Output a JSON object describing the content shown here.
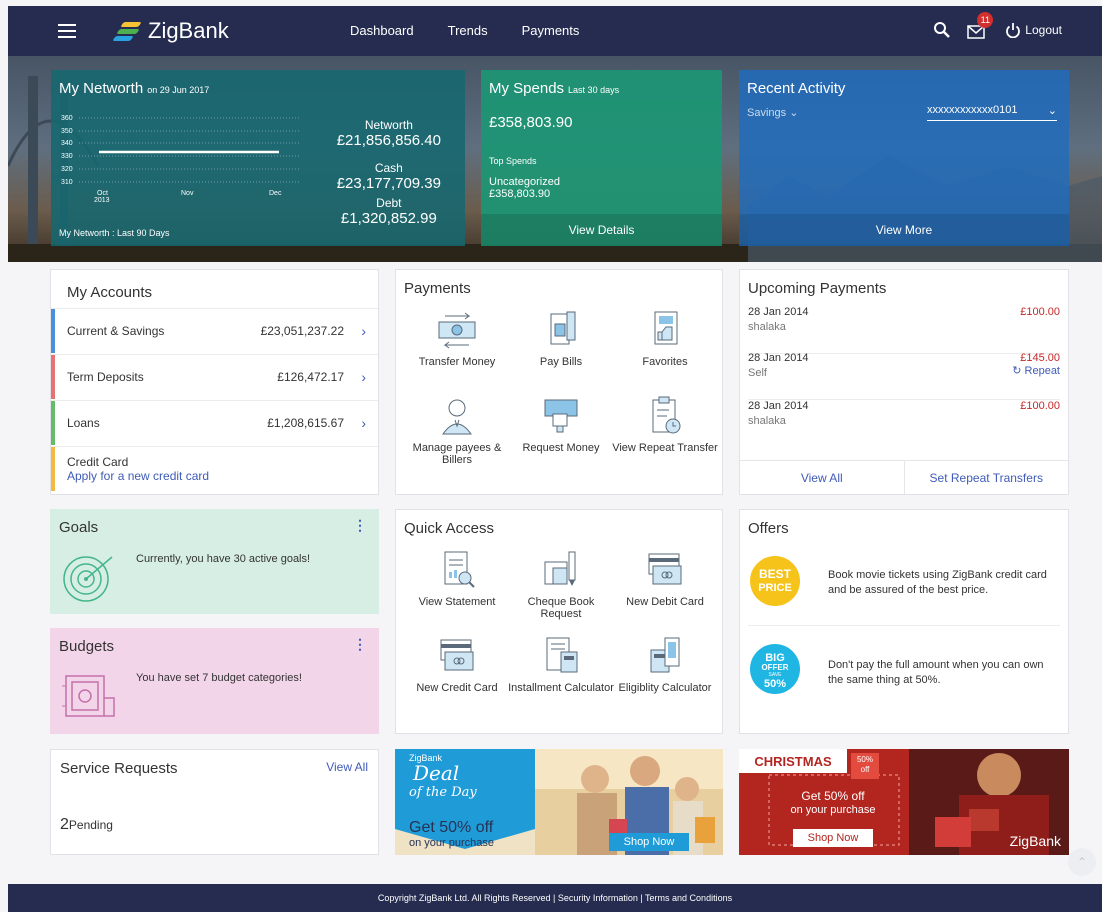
{
  "header": {
    "brand": "ZigBank",
    "nav": [
      "Dashboard",
      "Trends",
      "Payments"
    ],
    "mail_count": "11",
    "logout": "Logout"
  },
  "networth": {
    "title": "My Networth",
    "date": "on 29 Jun 2017",
    "y_ticks": [
      "360",
      "350",
      "340",
      "330",
      "320",
      "310"
    ],
    "x_ticks": [
      "Oct\n2013",
      "Nov",
      "Dec"
    ],
    "networth_label": "Networth",
    "networth_value": "£21,856,856.40",
    "cash_label": "Cash",
    "cash_value": "£23,177,709.39",
    "debt_label": "Debt",
    "debt_value": "£1,320,852.99",
    "footer": "My Networth : Last 90 Days"
  },
  "spends": {
    "title": "My Spends",
    "period": "Last 30 days",
    "amount": "£358,803.90",
    "top_label": "Top Spends",
    "category": "Uncategorized",
    "category_amount": "£358,803.90",
    "action": "View Details"
  },
  "activity": {
    "title": "Recent Activity",
    "filter": "Savings",
    "account": "xxxxxxxxxxxx0101",
    "action": "View More"
  },
  "accounts": {
    "title": "My Accounts",
    "rows": [
      {
        "name": "Current & Savings",
        "amount": "£23,051,237.22",
        "color": "#4a90d9"
      },
      {
        "name": "Term Deposits",
        "amount": "£126,472.17",
        "color": "#e57373"
      },
      {
        "name": "Loans",
        "amount": "£1,208,615.67",
        "color": "#66bb6a"
      },
      {
        "name": "Credit Card",
        "link": "Apply for a new credit card",
        "color": "#f4b942"
      }
    ]
  },
  "payments": {
    "title": "Payments",
    "tiles": [
      "Transfer Money",
      "Pay Bills",
      "Favorites",
      "Manage payees & Billers",
      "Request Money",
      "View Repeat Transfer"
    ]
  },
  "upcoming": {
    "title": "Upcoming Payments",
    "rows": [
      {
        "date": "28 Jan 2014",
        "who": "shalaka",
        "amount": "£100.00"
      },
      {
        "date": "28 Jan 2014",
        "who": "Self",
        "amount": "£145.00",
        "repeat": "Repeat"
      },
      {
        "date": "28 Jan 2014",
        "who": "shalaka",
        "amount": "£100.00"
      }
    ],
    "view_all": "View All",
    "set_repeat": "Set Repeat Transfers"
  },
  "goals": {
    "title": "Goals",
    "text": "Currently, you have 30 active goals!"
  },
  "budgets": {
    "title": "Budgets",
    "text": "You have set 7 budget categories!"
  },
  "quick": {
    "title": "Quick Access",
    "tiles": [
      "View Statement",
      "Cheque Book Request",
      "New Debit Card",
      "New Credit Card",
      "Installment Calculator",
      "Eligiblity Calculator"
    ]
  },
  "offers": {
    "title": "Offers",
    "items": [
      {
        "badge1": "BEST",
        "badge2": "PRICE",
        "text": "Book movie tickets using ZigBank credit card and be assured of the best price."
      },
      {
        "badge1": "BIG",
        "badge2": "OFFER",
        "badge3": "SAVE",
        "badge4": "50%",
        "text": "Don't pay the full amount when you can own the same thing at 50%."
      }
    ]
  },
  "service": {
    "title": "Service Requests",
    "view_all": "View All",
    "count": "2",
    "status": "Pending"
  },
  "deal": {
    "brand": "ZigBank",
    "line1": "Deal",
    "line2": "of the Day",
    "offer": "Get 50% off",
    "offer_sub": "on your purchase",
    "cta": "Shop Now"
  },
  "xmas": {
    "title": "CHRISTMAS",
    "tag1": "50%",
    "tag2": "off",
    "offer": "Get 50% off",
    "offer_sub": "on your purchase",
    "cta": "Shop Now",
    "brand": "ZigBank"
  },
  "footer": {
    "text": "Copyright ZigBank Ltd. All Rights Reserved | Security Information | Terms and Conditions"
  }
}
